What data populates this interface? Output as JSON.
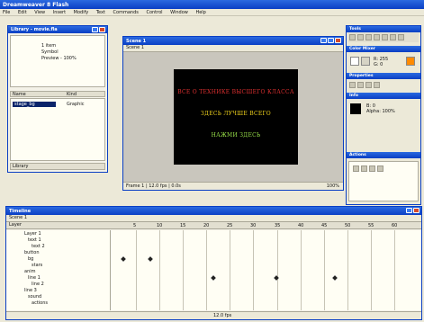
{
  "app": {
    "title": "Dreamweaver 8 Flash"
  },
  "menu": [
    "File",
    "Edit",
    "View",
    "Insert",
    "Modify",
    "Text",
    "Commands",
    "Control",
    "Window",
    "Help"
  ],
  "library_panel": {
    "title": "Library - movie.fla",
    "info_lines": [
      "1 item",
      "Symbol",
      "Preview - 100%"
    ],
    "columns": [
      "Name",
      "Kind"
    ],
    "items": [
      {
        "name": "stage_bg",
        "kind": "Graphic"
      }
    ],
    "footer": "Library"
  },
  "document": {
    "title": "Scene 1",
    "tab": "Scene 1",
    "stage_lines": [
      {
        "text": "ВСЕ О ТЕХНИКЕ ВЫСШЕГО КЛАССА",
        "color": "#e03030"
      },
      {
        "text": "ЗДЕСЬ ЛУЧШЕ ВСЕГО",
        "color": "#f0d21c"
      },
      {
        "text": "НАЖМИ ЗДЕСЬ",
        "color": "#9ae34a"
      }
    ],
    "status": "Frame 1 | 12.0 fps | 0.0s",
    "zoom": "100%"
  },
  "right_panel": {
    "tools_title": "Tools",
    "color_title": "Color Mixer",
    "properties_title": "Properties",
    "info_title": "Info",
    "swatches": [
      "#ffffff",
      "#d6d3c5",
      "#ff8a00",
      "#000000",
      "#4f7ad6",
      "#c0392b"
    ],
    "fields": [
      "R: 255",
      "G: 0",
      "B: 0",
      "Alpha: 100%"
    ],
    "actions_title": "Actions"
  },
  "timeline": {
    "title": "Timeline",
    "scene_label": "Scene 1",
    "layer_header": "Layer",
    "layers": [
      "Layer 1",
      "text 1",
      "text 2",
      "button",
      "bg",
      "stars",
      "anim",
      "line 1",
      "line 2",
      "line 3",
      "sound",
      "actions"
    ],
    "frame_labels": [
      "5",
      "10",
      "15",
      "20",
      "25",
      "30",
      "35",
      "40",
      "45",
      "50",
      "55",
      "60"
    ],
    "footer": "12.0 fps"
  },
  "colors": {
    "titlebar": "#0a3fc4",
    "stage": "#000000",
    "workspace": "#c9c6bd"
  }
}
